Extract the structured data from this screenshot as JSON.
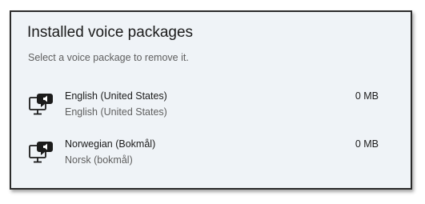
{
  "panel": {
    "title": "Installed voice packages",
    "subtitle": "Select a voice package to remove it."
  },
  "packages": [
    {
      "name": "English (United States)",
      "native_name": "English (United States)",
      "size": "0 MB",
      "icon": "voice-package-icon"
    },
    {
      "name": "Norwegian (Bokmål)",
      "native_name": "Norsk (bokmål)",
      "size": "0 MB",
      "icon": "voice-package-icon"
    }
  ]
}
